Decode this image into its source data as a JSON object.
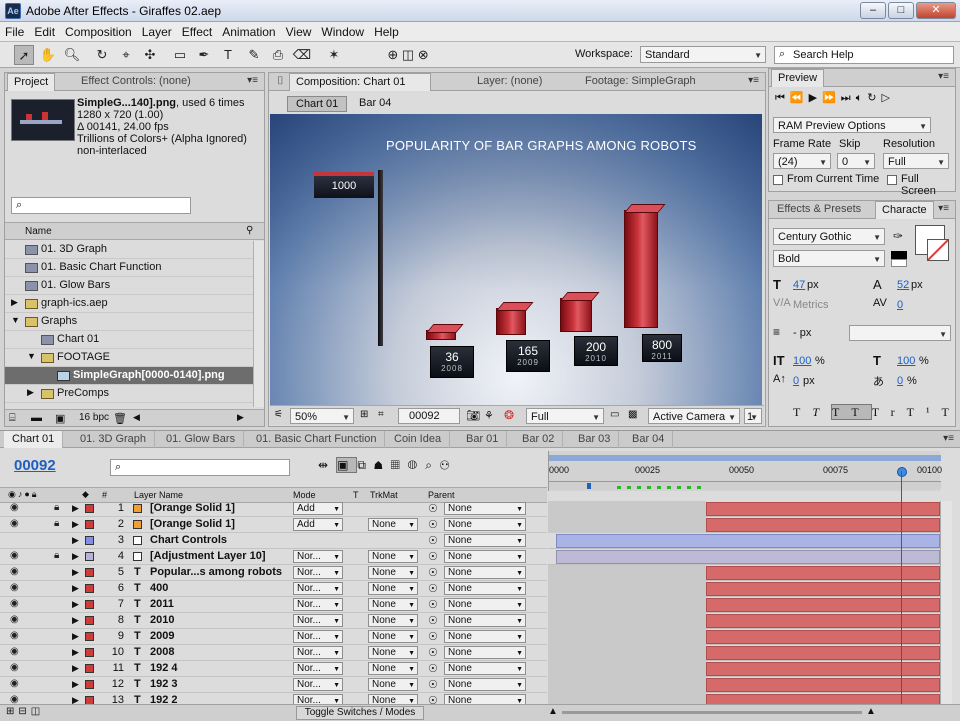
{
  "window": {
    "title": "Adobe After Effects - Giraffes 02.aep",
    "app_icon": "Ae",
    "minimize": "–",
    "maximize": "□",
    "close": "✕"
  },
  "menu": [
    "File",
    "Edit",
    "Composition",
    "Layer",
    "Effect",
    "Animation",
    "View",
    "Window",
    "Help"
  ],
  "toolbar": {
    "workspace_label": "Workspace:",
    "workspace_value": "Standard",
    "search_placeholder": "Search Help"
  },
  "project_panel": {
    "tabs": [
      "Project",
      "Effect Controls: (none)"
    ],
    "thumb_name": "SimpleG...140].png",
    "thumb_used": ", used 6 times",
    "info": [
      "1280 x 720 (1.00)",
      "Δ 00141, 24.00 fps",
      "Trillions of Colors+ (Alpha Ignored)",
      "non-interlaced"
    ],
    "column_name": "Name",
    "items": [
      {
        "label": "01. 3D Graph",
        "icon": "comp-icon"
      },
      {
        "label": "01. Basic Chart Function",
        "icon": "comp-icon"
      },
      {
        "label": "01. Glow Bars",
        "icon": "comp-icon"
      },
      {
        "label": "graph-ics.aep",
        "icon": "folder-icon"
      },
      {
        "label": "Graphs",
        "icon": "folder-icon"
      },
      {
        "label": "Chart 01",
        "icon": "comp-icon"
      },
      {
        "label": "FOOTAGE",
        "icon": "folder-icon"
      },
      {
        "label": "SimpleGraph[0000-0140].png",
        "icon": "footage-icon"
      },
      {
        "label": "PreComps",
        "icon": "folder-icon"
      }
    ],
    "bpc": "16 bpc"
  },
  "comp_panel": {
    "tabs": [
      "Composition: Chart 01",
      "Layer: (none)",
      "Footage: SimpleGraph"
    ],
    "breadcrumbs": [
      "Chart 01",
      "Bar 04"
    ],
    "title": "POPULARITY OF BAR GRAPHS AMONG ROBOTS",
    "flag_value": "1000",
    "labels": [
      {
        "n": "36",
        "y": "2008"
      },
      {
        "n": "165",
        "y": "2009"
      },
      {
        "n": "200",
        "y": "2010"
      },
      {
        "n": "800",
        "y": "2011"
      }
    ],
    "zoom": "50%",
    "timecode": "00092",
    "resolution": "Full",
    "camera": "Active Camera",
    "views": "1"
  },
  "preview_panel": {
    "title": "Preview",
    "ram_options": "RAM Preview Options",
    "frame_rate_label": "Frame Rate",
    "skip_label": "Skip",
    "resolution_label": "Resolution",
    "frame_rate": "(24)",
    "skip": "0",
    "resolution": "Full",
    "from_current": "From Current Time",
    "full_screen": "Full Screen"
  },
  "character_panel": {
    "tabs": [
      "Effects & Presets",
      "Characte"
    ],
    "font": "Century Gothic",
    "style": "Bold",
    "size": "47",
    "leading": "52",
    "kerning": "Metrics",
    "tracking": "0",
    "stroke": "- px",
    "vscale": "100",
    "hscale": "100",
    "baseline": "0",
    "tsume": "0",
    "unit_px": "px",
    "unit_pct": "%"
  },
  "timeline": {
    "tabs": [
      "Chart 01",
      "01. 3D Graph",
      "01. Glow Bars",
      "01. Basic Chart Function",
      "Coin Idea",
      "Bar 01",
      "Bar 02",
      "Bar 03",
      "Bar 04"
    ],
    "timecode": "00092",
    "columns": [
      "#",
      "Layer Name",
      "Mode",
      "T",
      "TrkMat",
      "Parent"
    ],
    "ruler": [
      "0000",
      "00025",
      "00050",
      "00075",
      "00100"
    ],
    "toggle_label": "Toggle Switches / Modes",
    "layers": [
      {
        "num": "1",
        "name": "[Orange Solid 1]",
        "mode": "Add",
        "trk": "",
        "parent": "None",
        "color": "#d23a3a",
        "kind": "solid",
        "lock": true
      },
      {
        "num": "2",
        "name": "[Orange Solid 1]",
        "mode": "Add",
        "trk": "None",
        "parent": "None",
        "color": "#d23a3a",
        "kind": "solid",
        "lock": true
      },
      {
        "num": "3",
        "name": "Chart Controls",
        "mode": "",
        "trk": "",
        "parent": "None",
        "color": "#7f8fe6",
        "kind": "null",
        "lock": false
      },
      {
        "num": "4",
        "name": "[Adjustment Layer 10]",
        "mode": "Nor...",
        "trk": "None",
        "parent": "None",
        "color": "#b4b2d8",
        "kind": "adj",
        "lock": true
      },
      {
        "num": "5",
        "name": "Popular...s among robots",
        "mode": "Nor...",
        "trk": "None",
        "parent": "None",
        "color": "#d23a3a",
        "kind": "text",
        "lock": false
      },
      {
        "num": "6",
        "name": "400",
        "mode": "Nor...",
        "trk": "None",
        "parent": "None",
        "color": "#d23a3a",
        "kind": "text",
        "lock": false
      },
      {
        "num": "7",
        "name": "2011",
        "mode": "Nor...",
        "trk": "None",
        "parent": "None",
        "color": "#d23a3a",
        "kind": "text",
        "lock": false
      },
      {
        "num": "8",
        "name": "2010",
        "mode": "Nor...",
        "trk": "None",
        "parent": "None",
        "color": "#d23a3a",
        "kind": "text",
        "lock": false
      },
      {
        "num": "9",
        "name": "2009",
        "mode": "Nor...",
        "trk": "None",
        "parent": "None",
        "color": "#d23a3a",
        "kind": "text",
        "lock": false
      },
      {
        "num": "10",
        "name": "2008",
        "mode": "Nor...",
        "trk": "None",
        "parent": "None",
        "color": "#d23a3a",
        "kind": "text",
        "lock": false
      },
      {
        "num": "11",
        "name": "192 4",
        "mode": "Nor...",
        "trk": "None",
        "parent": "None",
        "color": "#d23a3a",
        "kind": "text",
        "lock": false
      },
      {
        "num": "12",
        "name": "192 3",
        "mode": "Nor...",
        "trk": "None",
        "parent": "None",
        "color": "#d23a3a",
        "kind": "text",
        "lock": false
      },
      {
        "num": "13",
        "name": "192 2",
        "mode": "Nor...",
        "trk": "None",
        "parent": "None",
        "color": "#d23a3a",
        "kind": "text",
        "lock": false
      }
    ]
  },
  "colors": {
    "accent": "#1f5fbf",
    "label_red": "#d23a3a",
    "track_red": "#d66a6a",
    "playhead": "#e02020"
  }
}
